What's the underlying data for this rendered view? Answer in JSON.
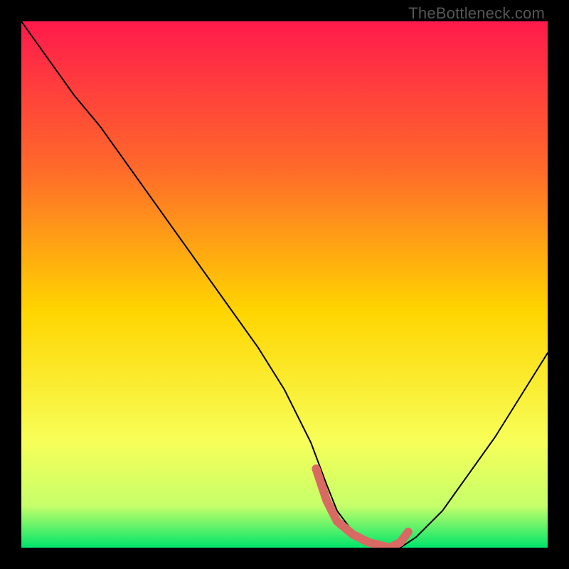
{
  "watermark": "TheBottleneck.com",
  "chart_data": {
    "type": "line",
    "title": "",
    "xlabel": "",
    "ylabel": "",
    "xlim": [
      0,
      100
    ],
    "ylim": [
      0,
      100
    ],
    "grid": false,
    "gradient_colors": {
      "top": "#ff1a4c",
      "upper_mid": "#ff6a2a",
      "mid": "#ffd500",
      "lower_mid": "#f7ff59",
      "near_bottom": "#c6ff6a",
      "bottom": "#00e56b"
    },
    "series": [
      {
        "name": "bottleneck-curve",
        "color": "#000000",
        "stroke_width": 2,
        "x": [
          0,
          5,
          10,
          15,
          20,
          25,
          30,
          35,
          40,
          45,
          50,
          55,
          58,
          60,
          63,
          66,
          70,
          72,
          75,
          80,
          85,
          90,
          95,
          100
        ],
        "values": [
          100,
          93,
          86,
          80,
          73,
          66,
          59,
          52,
          45,
          38,
          30,
          20,
          12,
          7,
          3,
          1,
          0,
          0,
          2,
          7,
          14,
          21,
          29,
          37
        ]
      },
      {
        "name": "highlight-band",
        "color": "#d96a63",
        "stroke_width": 10,
        "x": [
          56,
          58,
          60,
          63,
          66,
          70,
          72,
          73.5
        ],
        "values": [
          15,
          9,
          5,
          2.5,
          1,
          0,
          1,
          3
        ]
      }
    ],
    "annotations": []
  }
}
